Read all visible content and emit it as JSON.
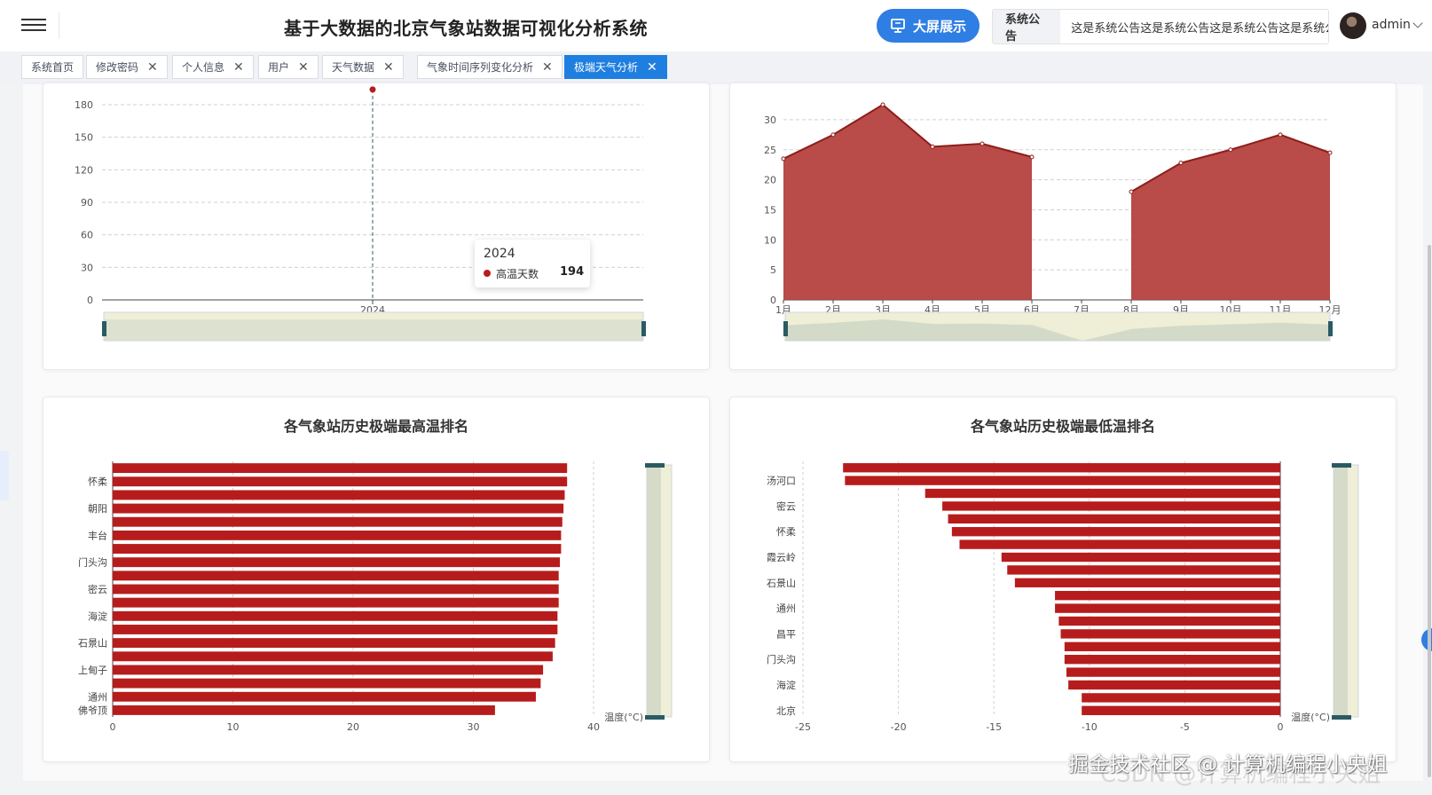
{
  "header": {
    "title": "基于大数据的北京气象站数据可视化分析系统",
    "bigscreen_label": "大屏展示",
    "notice_tag": "系统公告",
    "notice_text": "这是系统公告这是系统公告这是系统公告这是系统公告",
    "username": "admin"
  },
  "tabs": [
    {
      "label": "系统首页",
      "closable": false,
      "active": false
    },
    {
      "label": "修改密码",
      "closable": true,
      "active": false
    },
    {
      "label": "个人信息",
      "closable": true,
      "active": false
    },
    {
      "label": "用户",
      "closable": true,
      "active": false
    },
    {
      "label": "天气数据",
      "closable": true,
      "active": false
    },
    {
      "label": "气象时间序列变化分析",
      "closable": true,
      "active": false
    },
    {
      "label": "极端天气分析",
      "closable": true,
      "active": true
    }
  ],
  "tab_close_glyph": "✕",
  "tooltip": {
    "title": "2024",
    "series": "高温天数",
    "value": "194"
  },
  "watermark": "掘金技术社区 @ 计算机编程小央姐",
  "watermark_ghost": "CSDN @计算机编程小央姐",
  "colors": {
    "primary": "#1f7fe0",
    "series_red": "#b71c1c",
    "area_red": "#b5413e"
  },
  "chart_data": [
    {
      "id": "hot-days",
      "type": "line",
      "title": "",
      "categories": [
        "2024"
      ],
      "series": [
        {
          "name": "高温天数",
          "values": [
            194
          ]
        }
      ],
      "yticks": [
        0,
        30,
        60,
        90,
        120,
        150,
        180
      ],
      "ylim": [
        0,
        180
      ],
      "grid": true,
      "datazoom": true
    },
    {
      "id": "monthly-area",
      "type": "area",
      "title": "",
      "categories": [
        "1月",
        "2月",
        "3月",
        "4月",
        "5月",
        "6月",
        "7月",
        "8月",
        "9月",
        "10月",
        "11月",
        "12月"
      ],
      "values": [
        23.5,
        27.5,
        32.5,
        25.5,
        26,
        23.8,
        null,
        18,
        22.8,
        25,
        27.5,
        24.5
      ],
      "yticks": [
        0,
        5,
        10,
        15,
        20,
        25,
        30
      ],
      "ylim": [
        0,
        32.5
      ],
      "grid": true,
      "datazoom": true
    },
    {
      "id": "max-temp-rank",
      "type": "bar",
      "orientation": "horizontal",
      "title": "各气象站历史极端最高温排名",
      "unit_label": "温度(°C)",
      "category_labels_top_to_bottom": [
        "怀柔",
        "朝阳",
        "丰台",
        "门头沟",
        "密云",
        "海淀",
        "石景山",
        "上甸子",
        "通州",
        "佛爷顶"
      ],
      "values_top_to_bottom": [
        37.8,
        37.8,
        37.6,
        37.5,
        37.4,
        37.3,
        37.3,
        37.2,
        37.1,
        37.1,
        37.1,
        37.0,
        37.0,
        36.8,
        36.6,
        35.8,
        35.6,
        35.2,
        31.8
      ],
      "xticks": [
        0,
        10,
        20,
        30,
        40
      ],
      "xlim": [
        0,
        40
      ]
    },
    {
      "id": "min-temp-rank",
      "type": "bar",
      "orientation": "horizontal",
      "title": "各气象站历史极端最低温排名",
      "unit_label": "温度(°C)",
      "category_labels_top_to_bottom": [
        "汤河口",
        "密云",
        "怀柔",
        "霞云岭",
        "石景山",
        "通州",
        "昌平",
        "门头沟",
        "海淀",
        "北京"
      ],
      "values_top_to_bottom": [
        -22.9,
        -22.8,
        -18.6,
        -17.7,
        -17.4,
        -17.2,
        -16.8,
        -14.6,
        -14.3,
        -13.9,
        -11.8,
        -11.8,
        -11.6,
        -11.5,
        -11.3,
        -11.3,
        -11.2,
        -11.1,
        -10.4,
        -10.4
      ],
      "xticks": [
        -25,
        -20,
        -15,
        -10,
        -5,
        0
      ],
      "xlim": [
        -25,
        0
      ]
    }
  ]
}
